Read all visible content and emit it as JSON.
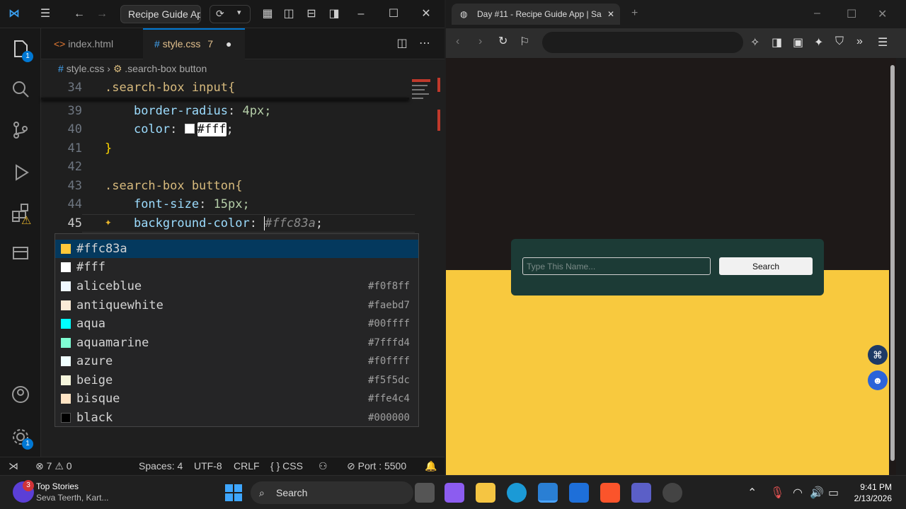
{
  "vscode": {
    "title": "Recipe Guide Ap",
    "tabs": [
      {
        "label": "index.html"
      },
      {
        "label": "style.css",
        "problems": "7"
      }
    ],
    "breadcrumb": {
      "file": "style.css",
      "symbol": ".search-box button"
    },
    "lines": [
      {
        "num": "34",
        "text": ".search-box input{"
      },
      {
        "num": "39",
        "indent": "    ",
        "prop": "border-radius",
        "value": "4px;"
      },
      {
        "num": "40",
        "indent": "    ",
        "prop": "color",
        "value": "#fff",
        "semi": ";"
      },
      {
        "num": "41",
        "text": "}"
      },
      {
        "num": "42",
        "text": ""
      },
      {
        "num": "43",
        "text": ".search-box button{"
      },
      {
        "num": "44",
        "indent": "    ",
        "prop": "font-size",
        "value": "15px;"
      },
      {
        "num": "45",
        "indent": "    ",
        "prop": "background-color",
        "ghost": "#ffc83a",
        "semi": ";"
      }
    ],
    "suggestions": [
      {
        "label": "#ffc83a",
        "detail": "",
        "color": "#ffc83a"
      },
      {
        "label": "#fff",
        "detail": "",
        "color": "#ffffff"
      },
      {
        "label": "aliceblue",
        "detail": "#f0f8ff",
        "color": "#f0f8ff"
      },
      {
        "label": "antiquewhite",
        "detail": "#faebd7",
        "color": "#faebd7"
      },
      {
        "label": "aqua",
        "detail": "#00ffff",
        "color": "#00ffff"
      },
      {
        "label": "aquamarine",
        "detail": "#7fffd4",
        "color": "#7fffd4"
      },
      {
        "label": "azure",
        "detail": "#f0ffff",
        "color": "#f0ffff"
      },
      {
        "label": "beige",
        "detail": "#f5f5dc",
        "color": "#f5f5dc"
      },
      {
        "label": "bisque",
        "detail": "#ffe4c4",
        "color": "#ffe4c4"
      },
      {
        "label": "black",
        "detail": "#000000",
        "color": "#000000"
      }
    ],
    "activity_badges": {
      "explorer": "1",
      "settings": "1"
    },
    "status": {
      "errors": "7",
      "warnings": "0",
      "spaces": "Spaces: 4",
      "encoding": "UTF-8",
      "eol": "CRLF",
      "language": "CSS",
      "port": "Port : 5500"
    }
  },
  "browser": {
    "tab_title": "Day #11 - Recipe Guide App | Sa",
    "page": {
      "search_placeholder": "Type This Name...",
      "search_button": "Search"
    }
  },
  "taskbar": {
    "news_title": "Top Stories",
    "news_sub": "Seva Teerth, Kart...",
    "news_badge": "3",
    "search": "Search",
    "time": "9:41 PM",
    "date": "2/13/2026"
  },
  "colors": {
    "accent": "#0078d4",
    "page_dark": "#1e1918",
    "page_yellow": "#f8c93e",
    "card": "#1c3b36"
  }
}
